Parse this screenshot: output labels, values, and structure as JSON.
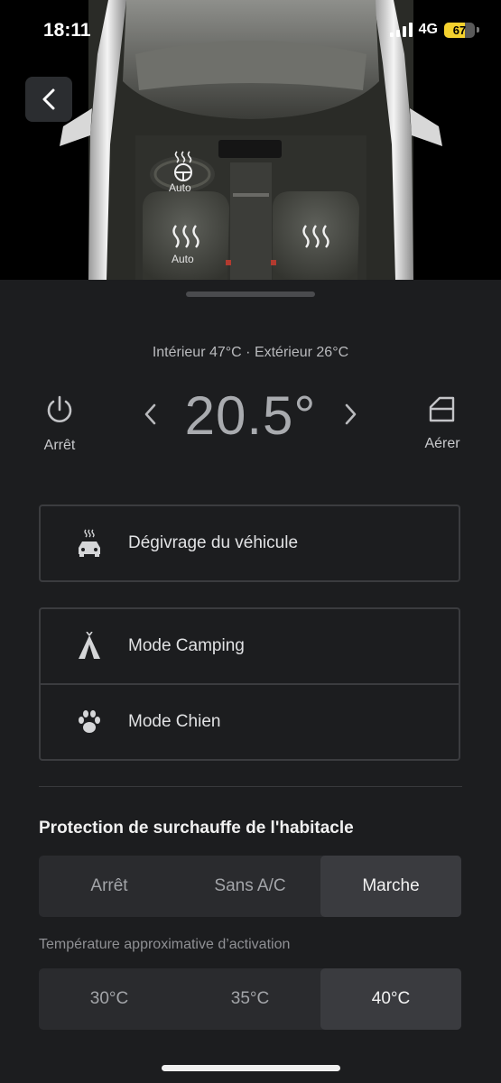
{
  "status_bar": {
    "time": "18:11",
    "network": "4G",
    "battery": "67",
    "battery_level": 0.67
  },
  "car_view": {
    "steering_wheel_heat": "Auto",
    "left_seat_heat": "Auto"
  },
  "climate": {
    "temps_line": "Intérieur 47°C  ·  Extérieur 26°C",
    "set_temp": "20.5°",
    "power_label": "Arrêt",
    "vent_label": "Aérer"
  },
  "defrost": {
    "label": "Dégivrage du véhicule"
  },
  "modes": {
    "camping": "Mode Camping",
    "dog": "Mode Chien"
  },
  "overheat": {
    "title": "Protection de surchauffe de l'habitacle",
    "options": [
      "Arrêt",
      "Sans A/C",
      "Marche"
    ],
    "selected": "Marche",
    "activation_label": "Température approximative d’activation",
    "temps": [
      "30°C",
      "35°C",
      "40°C"
    ],
    "selected_temp": "40°C"
  },
  "colors": {
    "background": "#1c1d1f",
    "segment_bg": "#2a2b2e",
    "segment_active": "#3a3b3f",
    "battery_fill": "#f5d22e"
  }
}
